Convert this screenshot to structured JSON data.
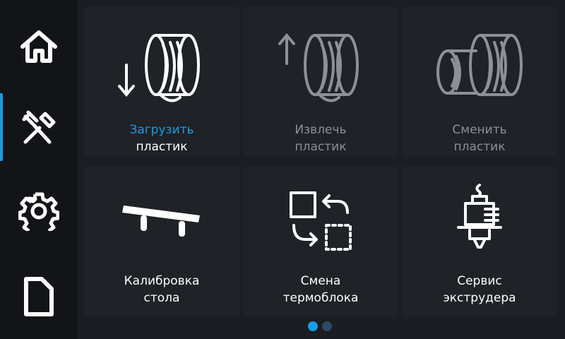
{
  "sidebar": {
    "items": [
      {
        "icon": "home-icon"
      },
      {
        "icon": "tools-icon",
        "active": true
      },
      {
        "icon": "gear-icon"
      },
      {
        "icon": "file-icon"
      }
    ],
    "accent_color": "#1a9be6"
  },
  "tiles": [
    {
      "line1": "Загрузить",
      "line2": "пластик",
      "icon": "load-filament-icon",
      "enabled": true
    },
    {
      "line1": "Извлечь",
      "line2": "пластик",
      "icon": "unload-filament-icon",
      "enabled": false
    },
    {
      "line1": "Сменить",
      "line2": "пластик",
      "icon": "change-filament-icon",
      "enabled": false
    },
    {
      "line1": "Калибровка",
      "line2": "стола",
      "icon": "bed-calibration-icon",
      "enabled": true
    },
    {
      "line1": "Смена",
      "line2": "термоблока",
      "icon": "hotend-swap-icon",
      "enabled": true
    },
    {
      "line1": "Сервис",
      "line2": "экструдера",
      "icon": "extruder-service-icon",
      "enabled": true
    }
  ],
  "pagination": {
    "current": 1,
    "total": 2,
    "active_color": "#1a9be6",
    "inactive_color": "#2d4a66"
  },
  "colors": {
    "disabled_text": "#8d9094",
    "text": "#ffffff"
  }
}
